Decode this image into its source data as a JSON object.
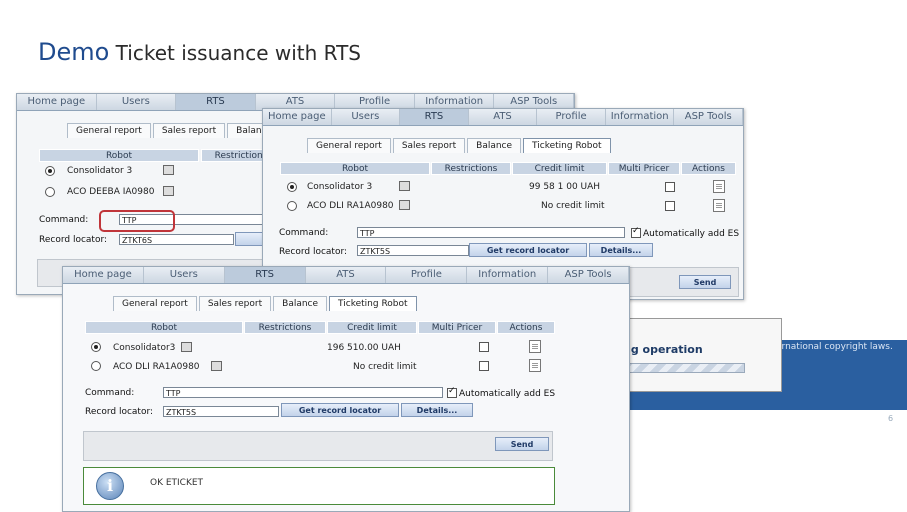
{
  "slide": {
    "title_demo": "Demo",
    "title_rest": " Ticket issuance with RTS",
    "page_number": "6"
  },
  "colors": {
    "title_blue": "#1f4b8e",
    "nav_bg": "#cdd7e2",
    "header_bg": "#c8d4e3",
    "banner_blue": "#2a5fa0",
    "highlight_red": "#c0353a",
    "ok_border": "#4a8a3a"
  },
  "nav": [
    "Home page",
    "Users",
    "RTS",
    "ATS",
    "Profile",
    "Information",
    "ASP Tools"
  ],
  "tabs_back": [
    "General report",
    "Sales report",
    "Balan"
  ],
  "tabs": [
    "General report",
    "Sales report",
    "Balance",
    "Ticketing Robot"
  ],
  "columns": {
    "robot": "Robot",
    "restrictions": "Restrictions",
    "credit_limit": "Credit limit",
    "multi_pricer": "Multi Pricer",
    "actions": "Actions"
  },
  "back": {
    "rows": [
      {
        "robot": "Consolidator 3"
      },
      {
        "robot": "ACO DEEBA IA0980"
      }
    ],
    "command": "TTP",
    "record_locator": "ZTKT6S"
  },
  "middle": {
    "rows": [
      {
        "robot": "Consolidator 3",
        "credit": "99 58 1 00 UAH"
      },
      {
        "robot": "ACO DLI RA1A0980",
        "credit": "No credit limit"
      }
    ],
    "command": "TTP",
    "record_locator": "ZTKT5S"
  },
  "front": {
    "rows": [
      {
        "robot": "Consolidator3",
        "credit": "196 510.00 UAH"
      },
      {
        "robot": "ACO DLI RA1A0980",
        "credit": "No credit limit"
      }
    ],
    "command": "TTP",
    "record_locator": "ZTKT5S",
    "result": "OK ETICKET"
  },
  "labels": {
    "command": "Command:",
    "record_locator": "Record locator:",
    "auto_es": "Automatically add ES",
    "get_record_locator": "Get record locator",
    "details": "Details...",
    "send": "Send"
  },
  "overlay": {
    "operation": "ng operation",
    "copyright": "ernational copyright laws."
  }
}
